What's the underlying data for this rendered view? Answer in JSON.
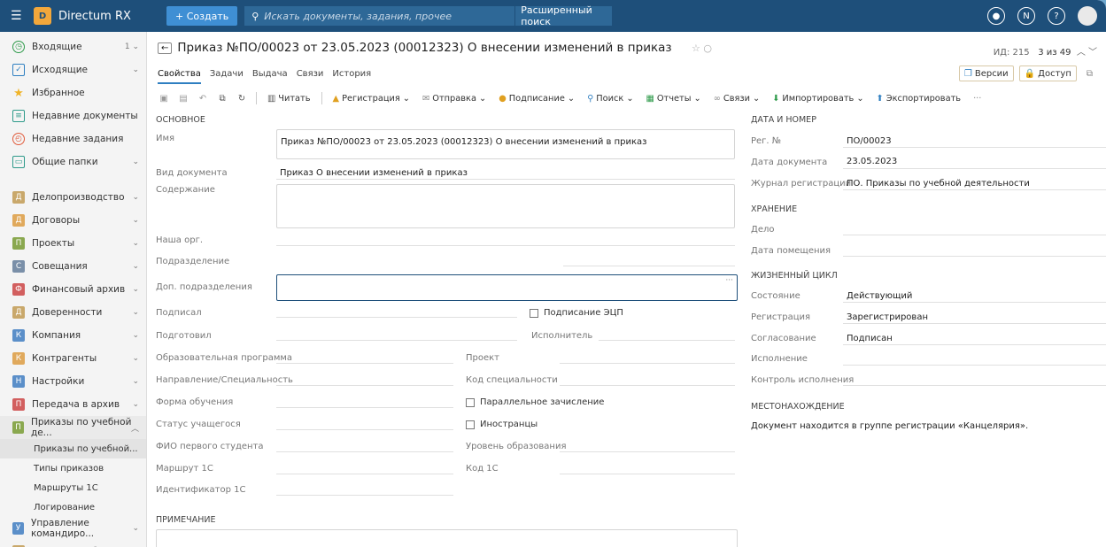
{
  "topbar": {
    "app_title": "Directum RX",
    "create_label": "+ Создать",
    "search_placeholder": "Искать документы, задания, прочее",
    "advanced_search": "Расширенный поиск"
  },
  "sidebar": {
    "items": [
      {
        "label": "Входящие",
        "badge": "1"
      },
      {
        "label": "Исходящие"
      },
      {
        "label": "Избранное"
      },
      {
        "label": "Недавние документы"
      },
      {
        "label": "Недавние задания"
      },
      {
        "label": "Общие папки"
      }
    ],
    "modules": [
      {
        "letter": "Д",
        "label": "Делопроизводство",
        "color": "#c9a86b"
      },
      {
        "letter": "Д",
        "label": "Договоры",
        "color": "#e0a95c"
      },
      {
        "letter": "П",
        "label": "Проекты",
        "color": "#8aa84f"
      },
      {
        "letter": "С",
        "label": "Совещания",
        "color": "#7a8fa8"
      },
      {
        "letter": "Ф",
        "label": "Финансовый архив",
        "color": "#d25f5f"
      },
      {
        "letter": "Д",
        "label": "Доверенности",
        "color": "#c9a86b"
      },
      {
        "letter": "К",
        "label": "Компания",
        "color": "#5b8fc9"
      },
      {
        "letter": "К",
        "label": "Контрагенты",
        "color": "#e0a95c"
      },
      {
        "letter": "Н",
        "label": "Настройки",
        "color": "#5b8fc9"
      },
      {
        "letter": "П",
        "label": "Передача в архив",
        "color": "#d25f5f"
      },
      {
        "letter": "П",
        "label": "Приказы по учебной де...",
        "color": "#8aa84f"
      }
    ],
    "subitems": [
      "Приказы по учебной...",
      "Типы приказов",
      "Маршруты 1С",
      "Логирование"
    ],
    "modules_bottom": [
      {
        "letter": "У",
        "label": "Управление командиро...",
        "color": "#5b8fc9"
      },
      {
        "letter": "Д",
        "label": "Документооборот",
        "color": "#c9a86b"
      }
    ]
  },
  "header": {
    "title": "Приказ №ПО/00023 от 23.05.2023 (00012323) О внесении изменений в приказ",
    "id_label": "ИД: 215",
    "paging": "3 из 49"
  },
  "tabs": [
    "Свойства",
    "Задачи",
    "Выдача",
    "Связи",
    "История"
  ],
  "header_buttons": {
    "versions": "Версии",
    "access": "Доступ"
  },
  "toolbar": [
    "Читать",
    "Регистрация",
    "Отправка",
    "Подписание",
    "Поиск",
    "Отчеты",
    "Связи",
    "Импортировать",
    "Экспортировать"
  ],
  "form": {
    "section_main": "ОСНОВНОЕ",
    "name_label": "Имя",
    "name_value": "Приказ №ПО/00023 от 23.05.2023 (00012323) О внесении изменений в приказ",
    "doctype_label": "Вид документа",
    "doctype_value": "Приказ О внесении изменений в приказ",
    "content_label": "Содержание",
    "org_label": "Наша орг.",
    "dept_label": "Подразделение",
    "extra_dept_label": "Доп. подразделения",
    "signed_label": "Подписал",
    "eds_label": "Подписание ЭЦП",
    "prepared_label": "Подготовил",
    "executor_label": "Исполнитель",
    "program_label": "Образовательная программа",
    "project_label": "Проект",
    "direction_label": "Направление/Специальность",
    "spec_code_label": "Код специальности",
    "study_form_label": "Форма обучения",
    "parallel_label": "Параллельное зачисление",
    "student_status_label": "Статус учащегося",
    "foreign_label": "Иностранцы",
    "first_student_label": "ФИО первого студента",
    "edu_level_label": "Уровень образования",
    "route_label": "Маршрут 1С",
    "code_label": "Код 1С",
    "ident_label": "Идентификатор 1С",
    "note_section": "ПРИМЕЧАНИЕ"
  },
  "right": {
    "section_date": "ДАТА И НОМЕР",
    "reg_label": "Рег. №",
    "reg_value": "ПО/00023",
    "date_label": "Дата документа",
    "date_value": "23.05.2023",
    "journal_label": "Журнал регистрации",
    "journal_value": "ПО. Приказы по учебной деятельности",
    "section_storage": "ХРАНЕНИЕ",
    "case_label": "Дело",
    "place_date_label": "Дата помещения",
    "section_life": "ЖИЗНЕННЫЙ ЦИКЛ",
    "state_label": "Состояние",
    "state_value": "Действующий",
    "registration_label": "Регистрация",
    "registration_value": "Зарегистрирован",
    "approval_label": "Согласование",
    "approval_value": "Подписан",
    "execution_label": "Исполнение",
    "control_label": "Контроль исполнения",
    "section_location": "МЕСТОНАХОЖДЕНИЕ",
    "location_value": "Документ находится в группе регистрации «Канцелярия»."
  }
}
